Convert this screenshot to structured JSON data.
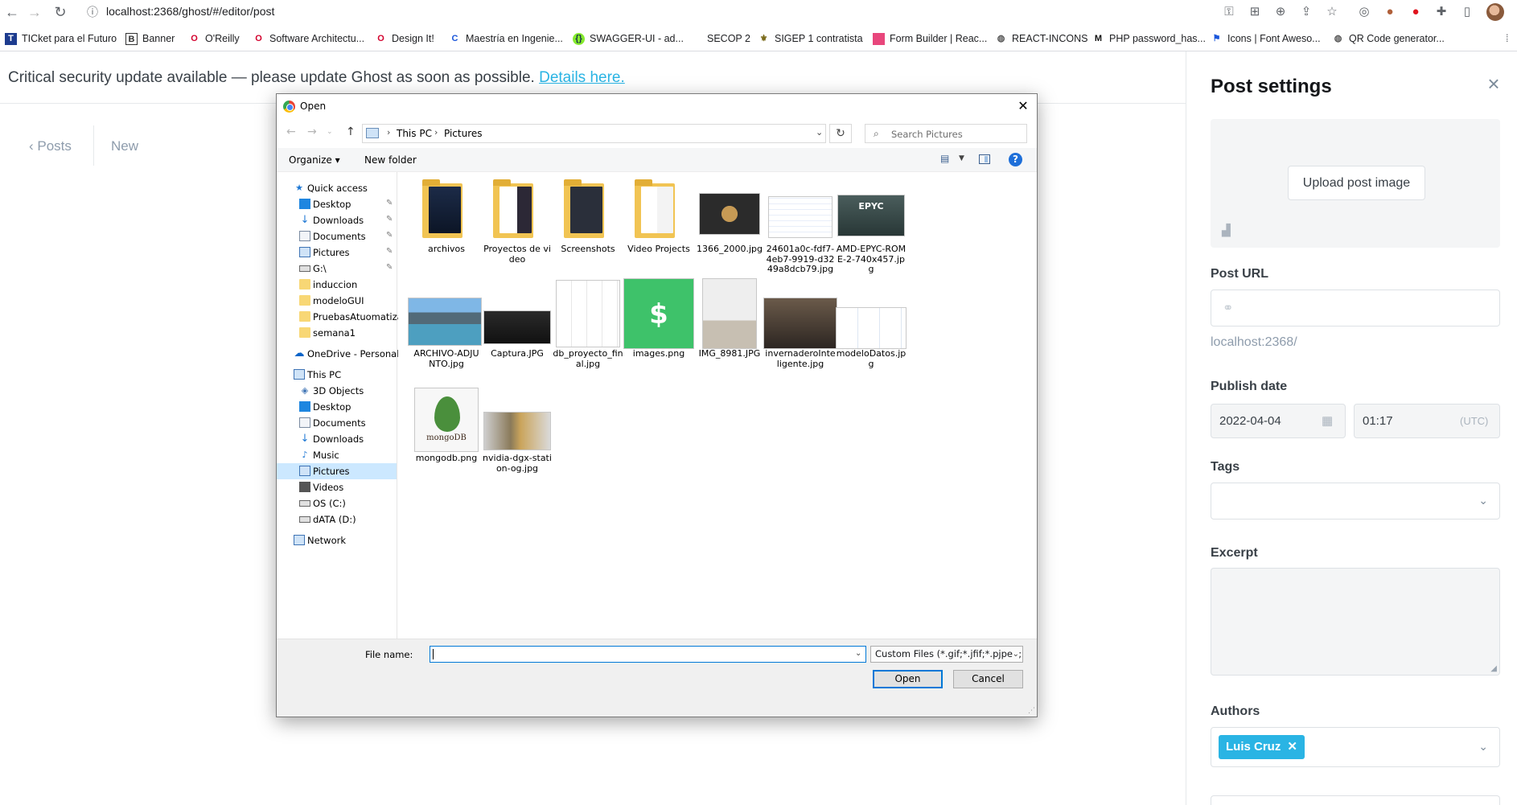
{
  "browser": {
    "url": "localhost:2368/ghost/#/editor/post",
    "bookmarks": [
      "TICket para el Futuro",
      "Banner",
      "O'Reilly",
      "Software Architectu...",
      "Design It!",
      "Maestría en Ingenie...",
      "SWAGGER-UI - ad...",
      "SECOP 2",
      "SIGEP 1 contratista",
      "Form Builder | Reac...",
      "REACT-INCONS",
      "PHP password_has...",
      "Icons | Font Aweso...",
      "QR Code generator..."
    ]
  },
  "editor": {
    "banner_text": "Critical security update available — please update Ghost as soon as possible.",
    "banner_link": "Details here.",
    "breadcrumb_posts": "Posts",
    "breadcrumb_new": "New"
  },
  "settings": {
    "title": "Post settings",
    "upload_label": "Upload post image",
    "post_url_label": "Post URL",
    "post_url_preview": "localhost:2368/",
    "publish_date_label": "Publish date",
    "date_value": "2022-04-04",
    "time_value": "01:17",
    "timezone": "(UTC)",
    "tags_label": "Tags",
    "excerpt_label": "Excerpt",
    "authors_label": "Authors",
    "author_name": "Luis Cruz",
    "accent_color": "#2ab4e4"
  },
  "dialog": {
    "title": "Open",
    "address": [
      "This PC",
      "Pictures"
    ],
    "search_placeholder": "Search Pictures",
    "organize_label": "Organize",
    "new_folder_label": "New folder",
    "nav": {
      "quick_access": "Quick access",
      "quick_items": [
        "Desktop",
        "Downloads",
        "Documents",
        "Pictures",
        "G:\\",
        "induccion",
        "modeloGUI",
        "PruebasAtuomatizadas",
        "semana1"
      ],
      "onedrive": "OneDrive - Personal",
      "this_pc": "This PC",
      "pc_items": [
        "3D Objects",
        "Desktop",
        "Documents",
        "Downloads",
        "Music",
        "Pictures",
        "Videos",
        "OS (C:)",
        "dATA (D:)"
      ],
      "network": "Network"
    },
    "files": [
      "archivos",
      "Proyectos de video",
      "Screenshots",
      "Video Projects",
      "1366_2000.jpg",
      "24601a0c-fdf7-4eb7-9919-d3249a8dcb79.jpg",
      "AMD-EPYC-ROME-2-740x457.jpg",
      "ARCHIVO-ADJUNTO.jpg",
      "Captura.JPG",
      "db_proyecto_final.jpg",
      "images.png",
      "IMG_8981.JPG",
      "invernaderoInteligente.jpg",
      "modeloDatos.jpg",
      "mongodb.png",
      "nvidia-dgx-station-og.jpg"
    ],
    "thumb_text": {
      "epyc": "EPYC",
      "mongo": "mongoDB",
      "dollar": "$"
    },
    "file_name_label": "File name:",
    "file_type": "Custom Files (*.gif;*.jfif;*.pjpeg;",
    "open_label": "Open",
    "cancel_label": "Cancel"
  }
}
